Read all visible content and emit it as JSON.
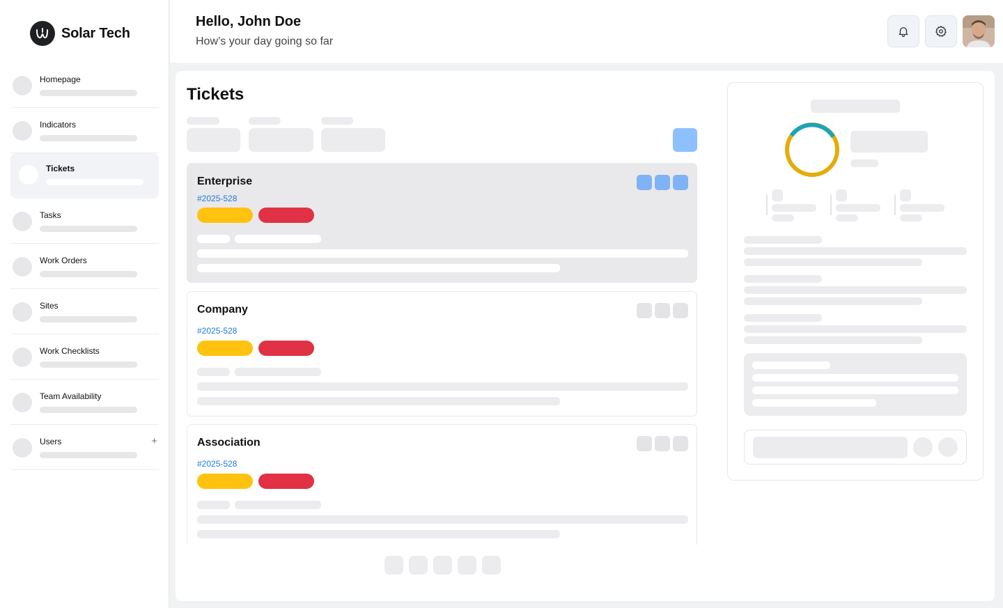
{
  "brand": {
    "name": "Solar Tech",
    "logo_icon": "logo-icon"
  },
  "sidebar": {
    "items": [
      {
        "label": "Homepage"
      },
      {
        "label": "Indicators"
      },
      {
        "label": "Tickets",
        "active": true
      },
      {
        "label": "Tasks"
      },
      {
        "label": "Work Orders"
      },
      {
        "label": "Sites"
      },
      {
        "label": "Work Checklists"
      },
      {
        "label": "Team Availability"
      },
      {
        "label": "Users",
        "plus": "+"
      }
    ]
  },
  "header": {
    "greeting": "Hello, John Doe",
    "subtitle": "How’s your day going so far",
    "bell_icon": "bell-icon",
    "settings_icon": "gear-icon"
  },
  "main": {
    "title": "Tickets",
    "cards": [
      {
        "title": "Enterprise",
        "id": "#2025-528"
      },
      {
        "title": "Company",
        "id": "#2025-528"
      },
      {
        "title": "Association",
        "id": "#2025-528"
      }
    ]
  },
  "colors": {
    "accent_blue": "#1e7ae0",
    "action_blue": "#7fb3f5",
    "pill_yellow": "#ffc20e",
    "pill_red": "#e03244",
    "donut_teal": "#1ba4b8",
    "donut_gold": "#e4ac0b"
  }
}
